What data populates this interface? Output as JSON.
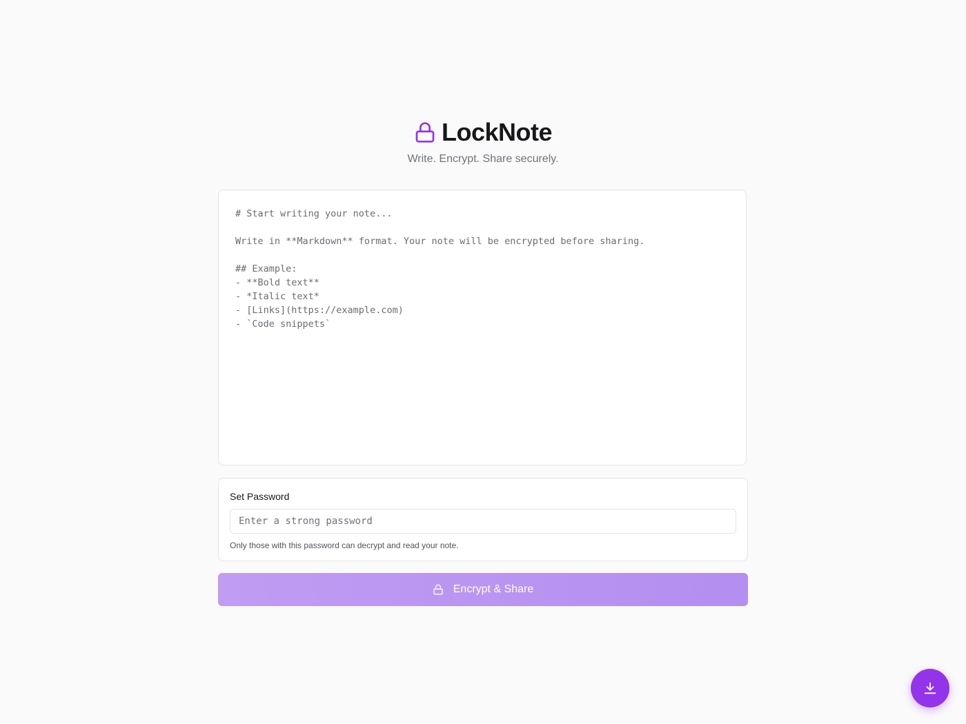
{
  "app": {
    "title": "LockNote",
    "subtitle": "Write. Encrypt. Share securely.",
    "accent_color": "#9333ea",
    "icon": "lock-icon"
  },
  "editor": {
    "placeholder": "# Start writing your note...\n\nWrite in **Markdown** format. Your note will be encrypted before sharing.\n\n## Example:\n- **Bold text**\n- *Italic text*\n- [Links](https://example.com)\n- `Code snippets`",
    "value": ""
  },
  "password": {
    "label": "Set Password",
    "placeholder": "Enter a strong password",
    "value": "",
    "help_text": "Only those with this password can decrypt and read your note."
  },
  "encrypt_button": {
    "label": "Encrypt & Share",
    "icon": "lock-icon",
    "state": "disabled"
  },
  "fab": {
    "icon": "download-icon"
  }
}
